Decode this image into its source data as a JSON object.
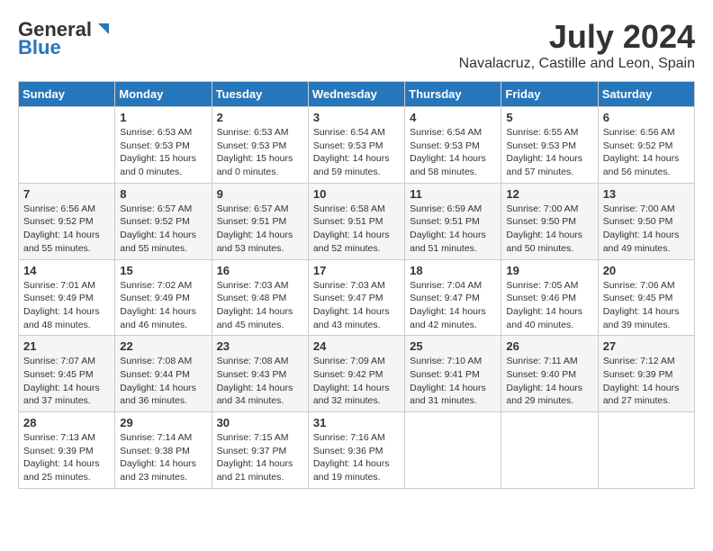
{
  "header": {
    "logo_general": "General",
    "logo_blue": "Blue",
    "month_year": "July 2024",
    "location": "Navalacruz, Castille and Leon, Spain"
  },
  "days_of_week": [
    "Sunday",
    "Monday",
    "Tuesday",
    "Wednesday",
    "Thursday",
    "Friday",
    "Saturday"
  ],
  "weeks": [
    [
      {
        "day": "",
        "info": ""
      },
      {
        "day": "1",
        "info": "Sunrise: 6:53 AM\nSunset: 9:53 PM\nDaylight: 15 hours\nand 0 minutes."
      },
      {
        "day": "2",
        "info": "Sunrise: 6:53 AM\nSunset: 9:53 PM\nDaylight: 15 hours\nand 0 minutes."
      },
      {
        "day": "3",
        "info": "Sunrise: 6:54 AM\nSunset: 9:53 PM\nDaylight: 14 hours\nand 59 minutes."
      },
      {
        "day": "4",
        "info": "Sunrise: 6:54 AM\nSunset: 9:53 PM\nDaylight: 14 hours\nand 58 minutes."
      },
      {
        "day": "5",
        "info": "Sunrise: 6:55 AM\nSunset: 9:53 PM\nDaylight: 14 hours\nand 57 minutes."
      },
      {
        "day": "6",
        "info": "Sunrise: 6:56 AM\nSunset: 9:52 PM\nDaylight: 14 hours\nand 56 minutes."
      }
    ],
    [
      {
        "day": "7",
        "info": "Sunrise: 6:56 AM\nSunset: 9:52 PM\nDaylight: 14 hours\nand 55 minutes."
      },
      {
        "day": "8",
        "info": "Sunrise: 6:57 AM\nSunset: 9:52 PM\nDaylight: 14 hours\nand 55 minutes."
      },
      {
        "day": "9",
        "info": "Sunrise: 6:57 AM\nSunset: 9:51 PM\nDaylight: 14 hours\nand 53 minutes."
      },
      {
        "day": "10",
        "info": "Sunrise: 6:58 AM\nSunset: 9:51 PM\nDaylight: 14 hours\nand 52 minutes."
      },
      {
        "day": "11",
        "info": "Sunrise: 6:59 AM\nSunset: 9:51 PM\nDaylight: 14 hours\nand 51 minutes."
      },
      {
        "day": "12",
        "info": "Sunrise: 7:00 AM\nSunset: 9:50 PM\nDaylight: 14 hours\nand 50 minutes."
      },
      {
        "day": "13",
        "info": "Sunrise: 7:00 AM\nSunset: 9:50 PM\nDaylight: 14 hours\nand 49 minutes."
      }
    ],
    [
      {
        "day": "14",
        "info": "Sunrise: 7:01 AM\nSunset: 9:49 PM\nDaylight: 14 hours\nand 48 minutes."
      },
      {
        "day": "15",
        "info": "Sunrise: 7:02 AM\nSunset: 9:49 PM\nDaylight: 14 hours\nand 46 minutes."
      },
      {
        "day": "16",
        "info": "Sunrise: 7:03 AM\nSunset: 9:48 PM\nDaylight: 14 hours\nand 45 minutes."
      },
      {
        "day": "17",
        "info": "Sunrise: 7:03 AM\nSunset: 9:47 PM\nDaylight: 14 hours\nand 43 minutes."
      },
      {
        "day": "18",
        "info": "Sunrise: 7:04 AM\nSunset: 9:47 PM\nDaylight: 14 hours\nand 42 minutes."
      },
      {
        "day": "19",
        "info": "Sunrise: 7:05 AM\nSunset: 9:46 PM\nDaylight: 14 hours\nand 40 minutes."
      },
      {
        "day": "20",
        "info": "Sunrise: 7:06 AM\nSunset: 9:45 PM\nDaylight: 14 hours\nand 39 minutes."
      }
    ],
    [
      {
        "day": "21",
        "info": "Sunrise: 7:07 AM\nSunset: 9:45 PM\nDaylight: 14 hours\nand 37 minutes."
      },
      {
        "day": "22",
        "info": "Sunrise: 7:08 AM\nSunset: 9:44 PM\nDaylight: 14 hours\nand 36 minutes."
      },
      {
        "day": "23",
        "info": "Sunrise: 7:08 AM\nSunset: 9:43 PM\nDaylight: 14 hours\nand 34 minutes."
      },
      {
        "day": "24",
        "info": "Sunrise: 7:09 AM\nSunset: 9:42 PM\nDaylight: 14 hours\nand 32 minutes."
      },
      {
        "day": "25",
        "info": "Sunrise: 7:10 AM\nSunset: 9:41 PM\nDaylight: 14 hours\nand 31 minutes."
      },
      {
        "day": "26",
        "info": "Sunrise: 7:11 AM\nSunset: 9:40 PM\nDaylight: 14 hours\nand 29 minutes."
      },
      {
        "day": "27",
        "info": "Sunrise: 7:12 AM\nSunset: 9:39 PM\nDaylight: 14 hours\nand 27 minutes."
      }
    ],
    [
      {
        "day": "28",
        "info": "Sunrise: 7:13 AM\nSunset: 9:39 PM\nDaylight: 14 hours\nand 25 minutes."
      },
      {
        "day": "29",
        "info": "Sunrise: 7:14 AM\nSunset: 9:38 PM\nDaylight: 14 hours\nand 23 minutes."
      },
      {
        "day": "30",
        "info": "Sunrise: 7:15 AM\nSunset: 9:37 PM\nDaylight: 14 hours\nand 21 minutes."
      },
      {
        "day": "31",
        "info": "Sunrise: 7:16 AM\nSunset: 9:36 PM\nDaylight: 14 hours\nand 19 minutes."
      },
      {
        "day": "",
        "info": ""
      },
      {
        "day": "",
        "info": ""
      },
      {
        "day": "",
        "info": ""
      }
    ]
  ]
}
